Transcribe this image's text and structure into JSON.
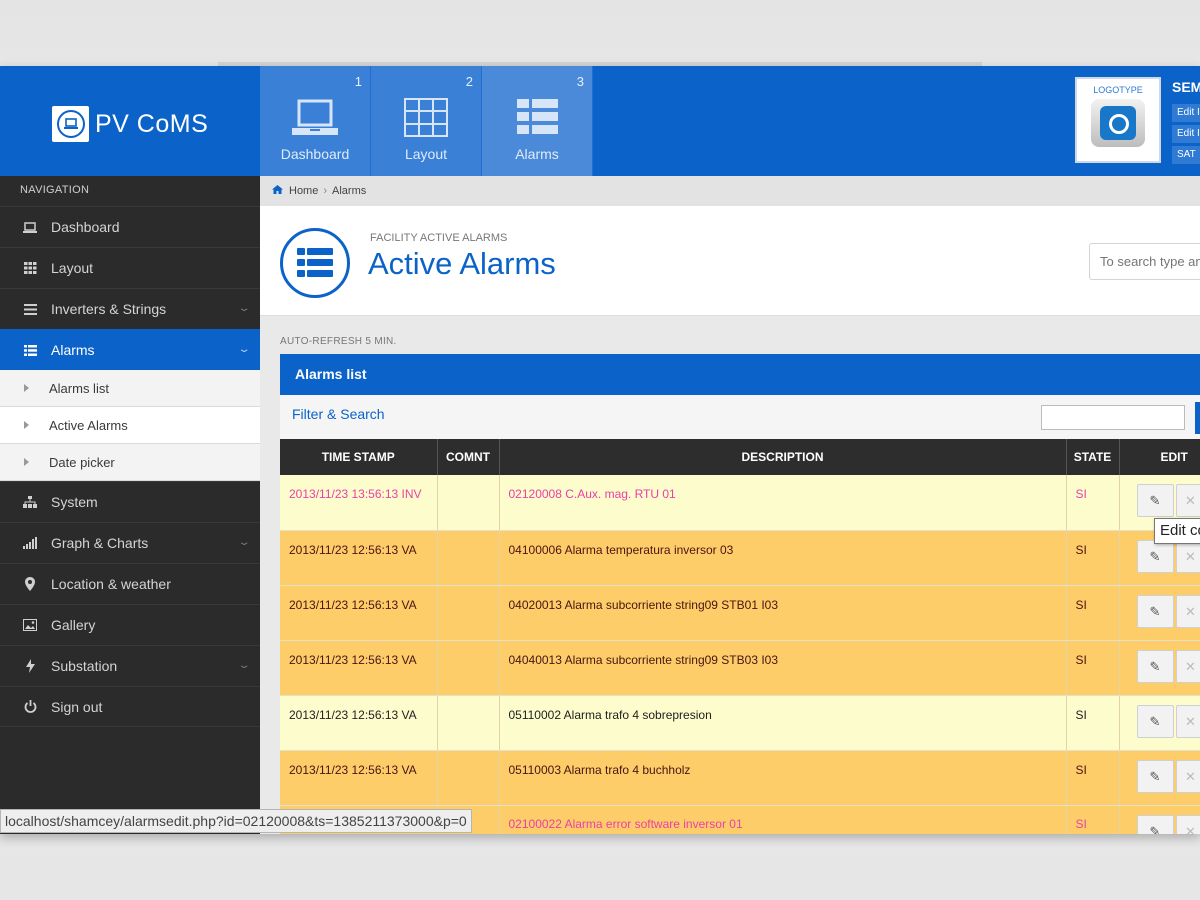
{
  "brand": {
    "name": "PV CoMS"
  },
  "tiles": [
    {
      "num": "1",
      "label": "Dashboard"
    },
    {
      "num": "2",
      "label": "Layout"
    },
    {
      "num": "3",
      "label": "Alarms"
    }
  ],
  "logo": {
    "text": "LOGOTYPE"
  },
  "user": {
    "name": "SEM",
    "buttons": [
      "Edit I",
      "Edit I",
      "SAT"
    ]
  },
  "sidebar": {
    "heading": "NAVIGATION",
    "items": [
      {
        "label": "Dashboard",
        "icon": "laptop-icon"
      },
      {
        "label": "Layout",
        "icon": "grid-icon"
      },
      {
        "label": "Inverters & Strings",
        "icon": "list-icon"
      },
      {
        "label": "Alarms",
        "icon": "list-icon"
      },
      {
        "label": "System",
        "icon": "sitemap-icon"
      },
      {
        "label": "Graph & Charts",
        "icon": "bar-chart-icon"
      },
      {
        "label": "Location & weather",
        "icon": "map-marker-icon"
      },
      {
        "label": "Gallery",
        "icon": "picture-icon"
      },
      {
        "label": "Substation",
        "icon": "bolt-icon"
      },
      {
        "label": "Sign out",
        "icon": "power-icon"
      }
    ],
    "subitems": [
      "Alarms list",
      "Active Alarms",
      "Date picker"
    ]
  },
  "breadcrumb": {
    "home": "Home",
    "current": "Alarms"
  },
  "page": {
    "kicker": "FACILITY ACTIVE ALARMS",
    "title": "Active Alarms",
    "search_placeholder": "To search type and hit enter"
  },
  "autorefresh": "AUTO-REFRESH 5 MIN.",
  "panel": {
    "title": "Alarms list",
    "filter_label": "Filter & Search"
  },
  "table": {
    "headers": [
      "TIME STAMP",
      "COMNT",
      "DESCRIPTION",
      "STATE",
      "EDIT"
    ],
    "rows": [
      {
        "ts": "2013/11/23 13:56:13 INV",
        "comnt": "",
        "desc": "02120008 C.Aux. mag. RTU 01",
        "state": "SI"
      },
      {
        "ts": "2013/11/23 12:56:13 VA",
        "comnt": "",
        "desc": "04100006 Alarma temperatura inversor 03",
        "state": "SI"
      },
      {
        "ts": "2013/11/23 12:56:13 VA",
        "comnt": "",
        "desc": "04020013 Alarma subcorriente string09 STB01 I03",
        "state": "SI"
      },
      {
        "ts": "2013/11/23 12:56:13 VA",
        "comnt": "",
        "desc": "04040013 Alarma subcorriente string09 STB03 I03",
        "state": "SI"
      },
      {
        "ts": "2013/11/23 12:56:13 VA",
        "comnt": "",
        "desc": "05110002 Alarma trafo 4 sobrepresion",
        "state": "SI"
      },
      {
        "ts": "2013/11/23 12:56:13 VA",
        "comnt": "",
        "desc": "05110003 Alarma trafo 4 buchholz",
        "state": "SI"
      },
      {
        "ts": "",
        "comnt": "",
        "desc": "02100022 Alarma error software inversor 01",
        "state": "SI"
      }
    ]
  },
  "tooltip": "Edit co",
  "statusbar": "localhost/shamcey/alarmsedit.php?id=02120008&ts=1385211373000&p=0",
  "colors": {
    "brand": "#0b63c9",
    "row_light": "#fdfccc",
    "row_orange": "#fdcd69",
    "alert_text": "#ea3fa7",
    "sidebar": "#2b2b2b"
  }
}
